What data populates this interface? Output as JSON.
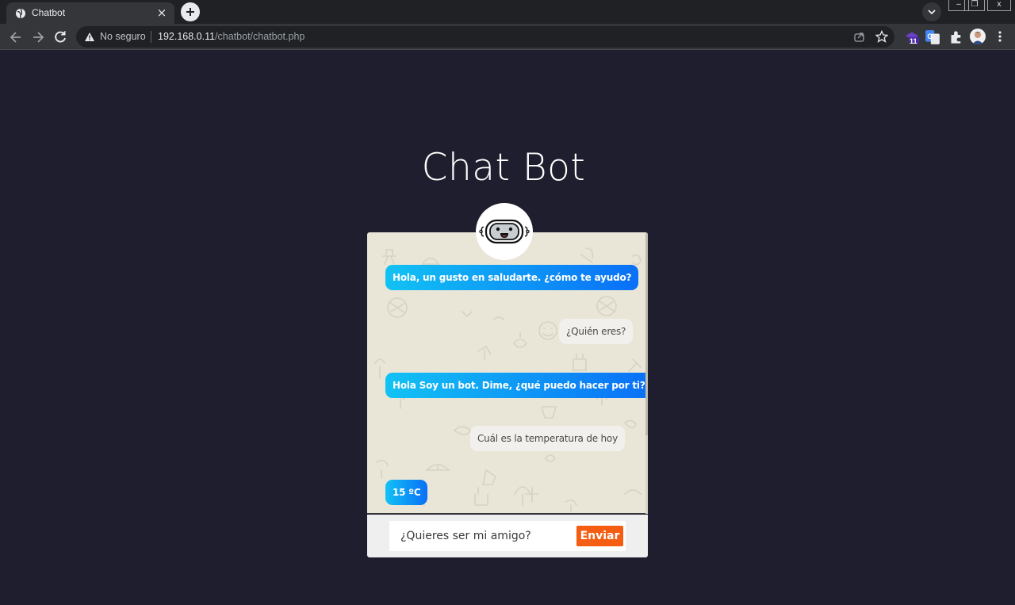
{
  "browser": {
    "tab_title": "Chatbot",
    "tab_close": "×",
    "security_label": "No seguro",
    "url_host": "192.168.0.11",
    "url_path": "/chatbot/chatbot.php",
    "extension_badge": "11",
    "window_controls": [
      "–",
      "❐",
      "x"
    ]
  },
  "page": {
    "title": "Chat Bot"
  },
  "chat": {
    "messages": [
      {
        "sender": "bot",
        "text": "Hola, un gusto en saludarte. ¿cómo te ayudo?"
      },
      {
        "sender": "user",
        "text": "¿Quién eres?"
      },
      {
        "sender": "bot",
        "text": "Hola Soy un bot. Dime, ¿qué puedo hacer por ti?"
      },
      {
        "sender": "user",
        "text": "Cuál es la temperatura de hoy"
      },
      {
        "sender": "bot",
        "text": "15 ºC"
      }
    ],
    "input_value": "¿Quieres ser mi amigo?",
    "send_label": "Enviar"
  },
  "colors": {
    "page_background": "#1f1e2e",
    "chat_background": "#e9e6d8",
    "bot_bubble_start": "#12c2f4",
    "bot_bubble_end": "#0a6ff7",
    "user_bubble": "#f1f0ec",
    "send_button": "#f45d12"
  },
  "icons": [
    "globe-icon",
    "close-icon",
    "plus-icon",
    "chevron-down-icon",
    "back-arrow-icon",
    "forward-arrow-icon",
    "reload-icon",
    "warning-icon",
    "share-icon",
    "star-icon",
    "extension-icon",
    "translate-icon",
    "puzzle-icon",
    "profile-avatar-icon",
    "menu-dots-icon",
    "robot-icon"
  ]
}
